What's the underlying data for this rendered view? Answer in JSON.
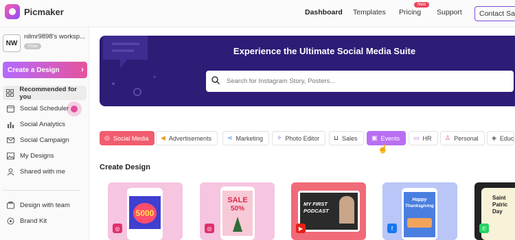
{
  "brand": {
    "name": "Picmaker"
  },
  "nav": {
    "dashboard": "Dashboard",
    "templates": "Templates",
    "pricing": "Pricing",
    "pricing_badge": "New",
    "support": "Support",
    "contact": "Contact Sales"
  },
  "workspace": {
    "initials": "NW",
    "name": "nilmr9898's worksp...",
    "plan": "Free"
  },
  "sidebar": {
    "create_label": "Create a Design",
    "items": [
      {
        "label": "Recommended for you",
        "icon": "recommended-icon"
      },
      {
        "label": "Social Scheduler",
        "icon": "calendar-icon"
      },
      {
        "label": "Social Analytics",
        "icon": "analytics-icon"
      },
      {
        "label": "Social Campaign",
        "icon": "mail-icon"
      },
      {
        "label": "My Designs",
        "icon": "image-icon"
      },
      {
        "label": "Shared with me",
        "icon": "shared-icon"
      }
    ],
    "bottom_items": [
      {
        "label": "Design with team",
        "icon": "team-icon"
      },
      {
        "label": "Brand Kit",
        "icon": "brand-kit-icon"
      }
    ]
  },
  "hero": {
    "title": "Experience the Ultimate Social Media Suite",
    "search_placeholder": "Search for Instagram Story, Posters..."
  },
  "categories": [
    {
      "label": "Social Media",
      "icon": "instagram-icon",
      "selected": true
    },
    {
      "label": "Advertisements",
      "icon": "megaphone-icon"
    },
    {
      "label": "Marketing",
      "icon": "share-icon"
    },
    {
      "label": "Photo Editor",
      "icon": "magic-wand-icon"
    },
    {
      "label": "Sales",
      "icon": "cart-icon"
    },
    {
      "label": "Events",
      "icon": "calendar-icon",
      "hovered": true
    },
    {
      "label": "HR",
      "icon": "briefcase-icon"
    },
    {
      "label": "Personal",
      "icon": "person-icon"
    },
    {
      "label": "Educ",
      "icon": "education-icon"
    }
  ],
  "section": {
    "title": "Create Design"
  },
  "cards": [
    {
      "text": "5000",
      "platform": "instagram-icon"
    },
    {
      "text_line1": "SALE",
      "text_line2": "50%",
      "platform": "instagram-icon"
    },
    {
      "text_line1": "MY FIRST",
      "text_line2": "PODCAST",
      "platform": "youtube-icon"
    },
    {
      "text_line1": "Happy",
      "text_line2": "Thanksgiving",
      "platform": "facebook-icon"
    },
    {
      "text_line1": "Saint",
      "text_line2": "Patric",
      "text_line3": "Day",
      "platform": "whatsapp-icon"
    }
  ],
  "colors": {
    "hero_bg": "#2e1c77",
    "chip_active": "#f05d6e",
    "chip_hover": "#b86ff2",
    "create_gradient_start": "#b46aff",
    "create_gradient_end": "#e5539b"
  }
}
